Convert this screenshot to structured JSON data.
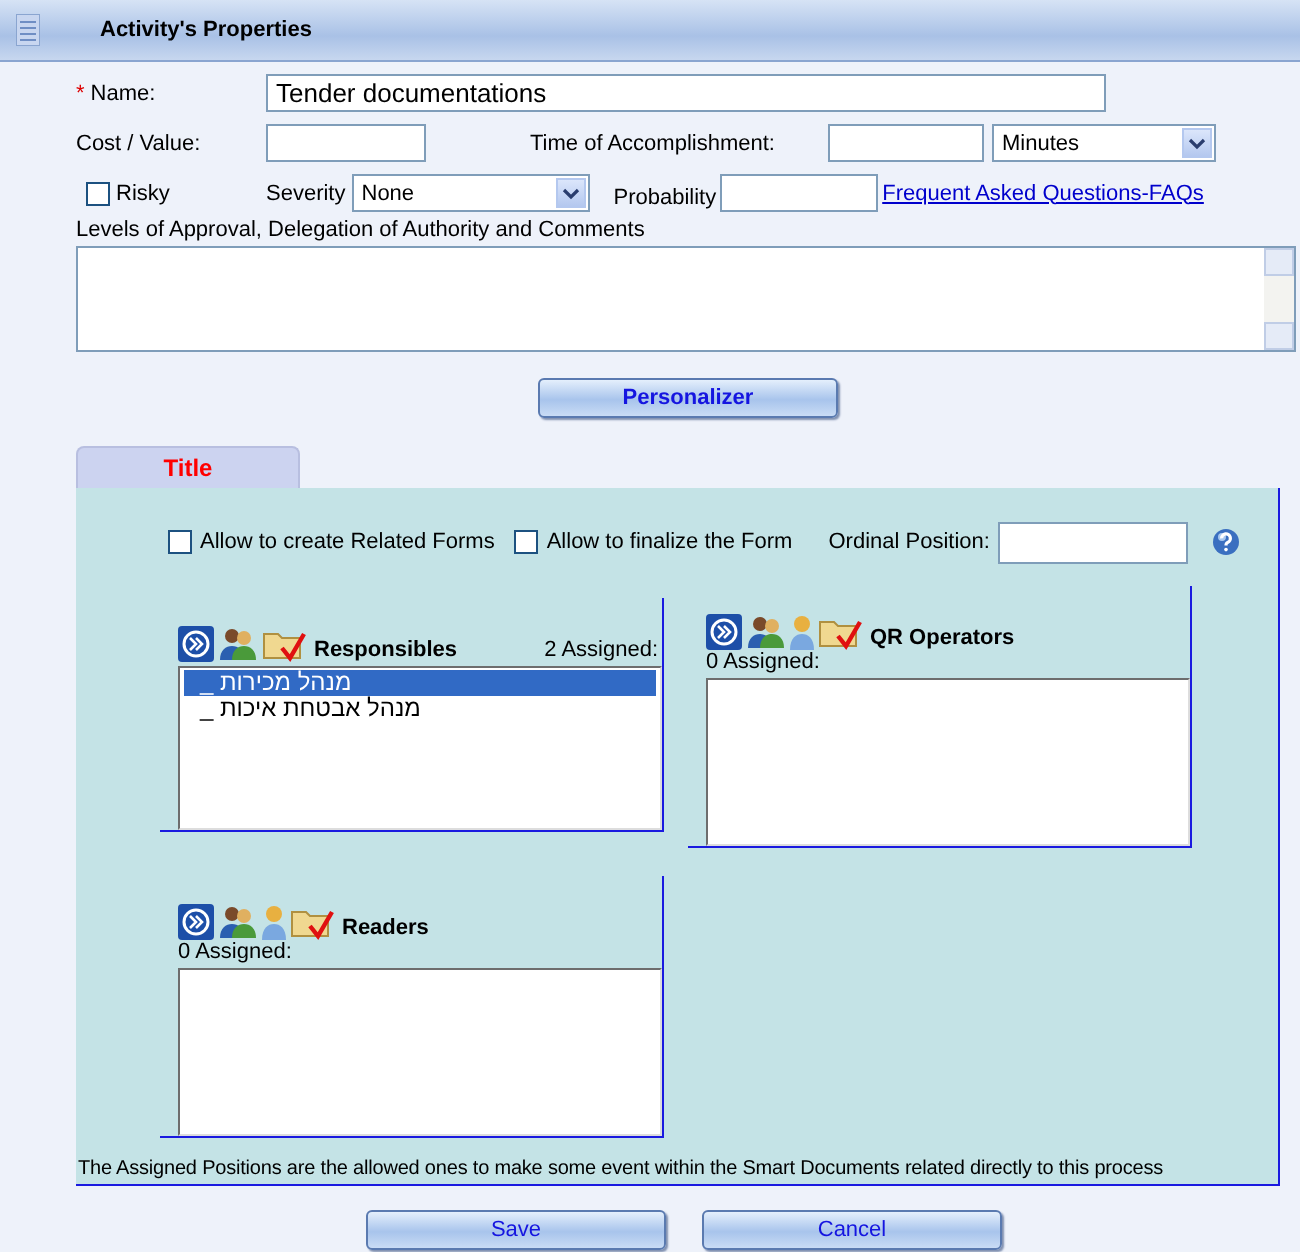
{
  "header": {
    "title": "Activity's Properties"
  },
  "form": {
    "name": {
      "label": "Name:",
      "required_mark": "*",
      "value": "Tender documentations"
    },
    "cost": {
      "label": "Cost / Value:"
    },
    "time": {
      "label": "Time of Accomplishment:",
      "unit": "Minutes"
    },
    "risky": {
      "label": "Risky",
      "checked": false
    },
    "severity": {
      "label": "Severity",
      "value": "None"
    },
    "probability": {
      "label": "Probability"
    },
    "faq_link": "Frequent Asked Questions-FAQs",
    "comments": {
      "label": "Levels of Approval, Delegation of Authority and Comments"
    }
  },
  "personalizer_button": "Personalizer",
  "tabs": [
    {
      "label": "Title",
      "selected": true
    }
  ],
  "options": [
    {
      "label": "Allow to create Related Forms",
      "checked": false
    },
    {
      "label": "Allow to finalize the Form",
      "checked": false
    }
  ],
  "ordinal_position": {
    "label": "Ordinal Position:"
  },
  "groups": [
    {
      "title": "Responsibles",
      "kind": "basic",
      "assigned": "2 Assigned:",
      "items": [
        {
          "text": "_ מנהל מכירות",
          "selected": true
        },
        {
          "text": "_ מנהל אבטחת איכות",
          "selected": false
        }
      ]
    },
    {
      "title": "QR Operators",
      "kind": "extended",
      "assigned": "0 Assigned:"
    },
    {
      "title": "Readers",
      "kind": "extended",
      "assigned": "0 Assigned:"
    }
  ],
  "footnote": "The Assigned Positions are the allowed ones to make some event within the Smart Documents related directly to this process",
  "buttons": [
    "Save",
    "Cancel"
  ]
}
